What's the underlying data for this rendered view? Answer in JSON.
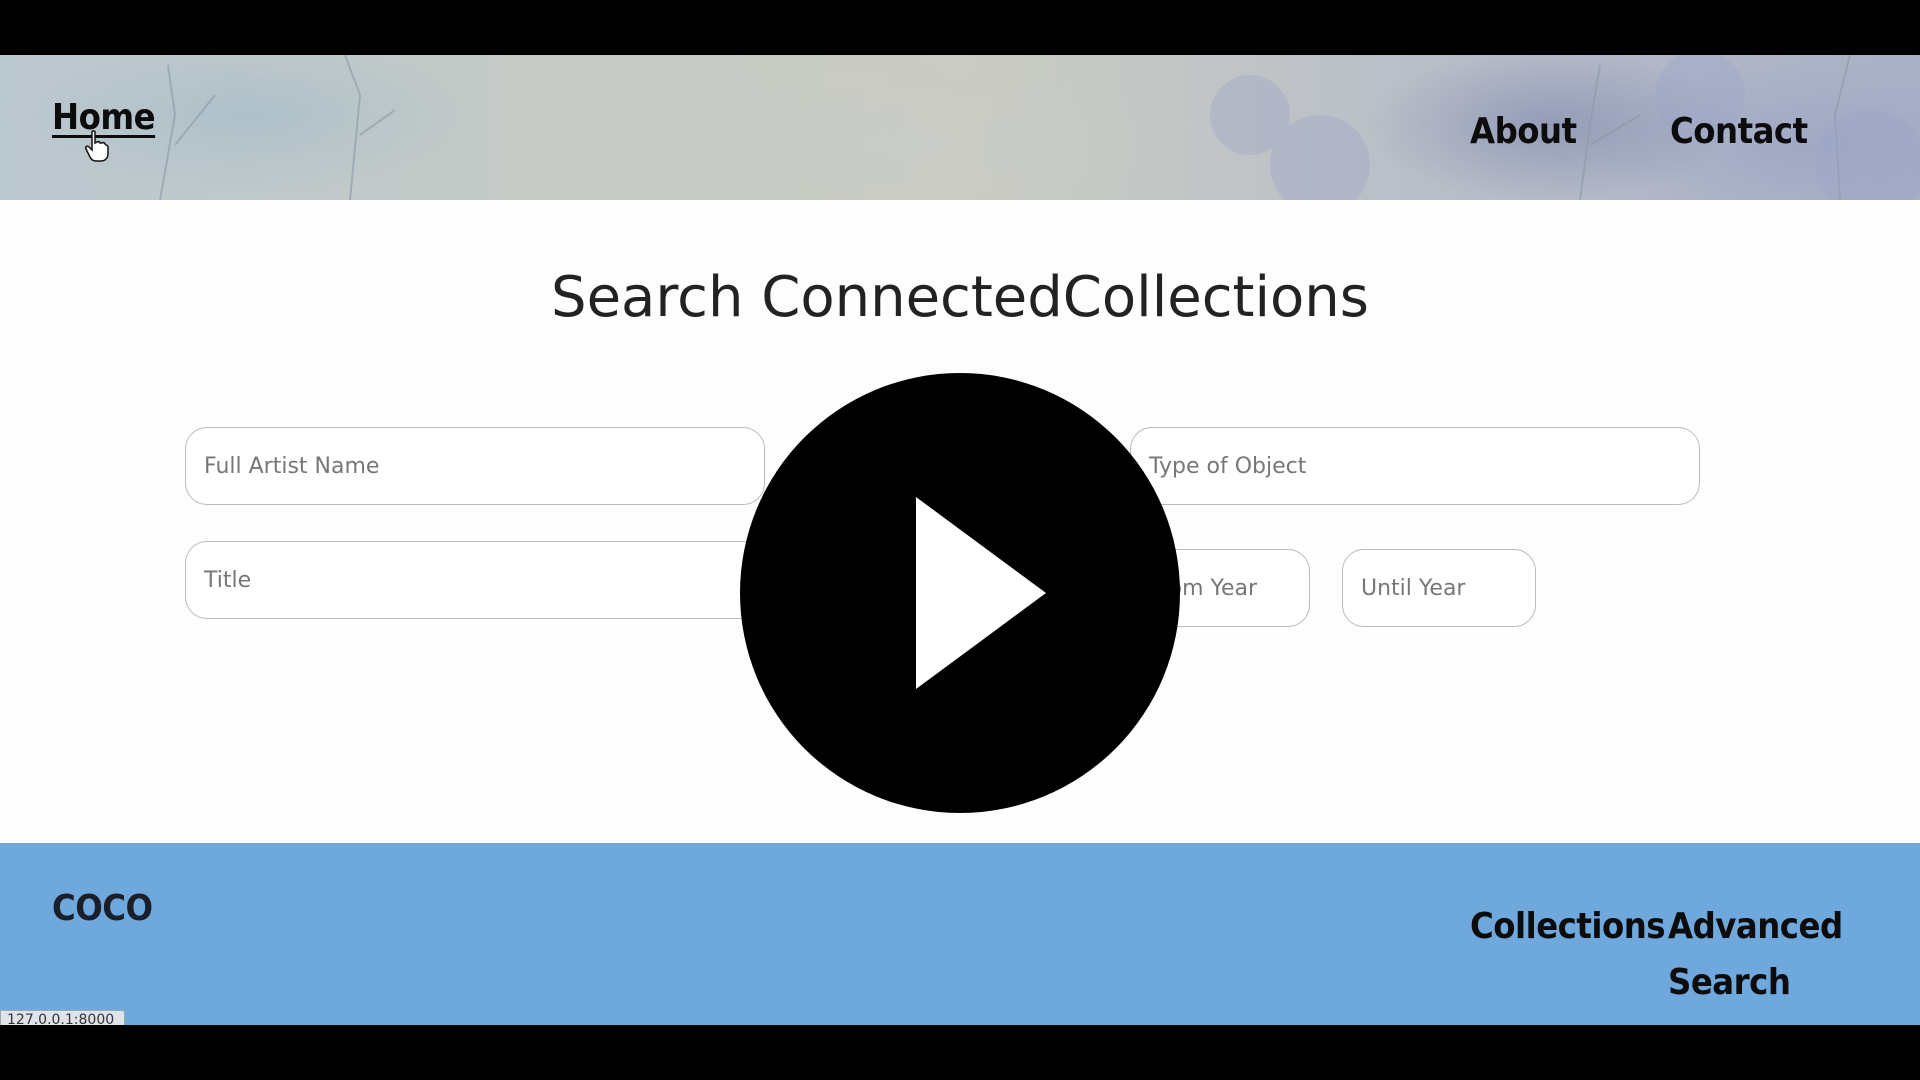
{
  "nav": {
    "home_label": "Home",
    "about_label": "About",
    "contact_label": "Contact"
  },
  "main": {
    "title": "Search ConnectedCollections",
    "inputs": {
      "artist_placeholder": "Full Artist Name",
      "object_placeholder": "Type of Object",
      "title_placeholder": "Title",
      "from_year_placeholder": "From Year",
      "until_year_placeholder": "Until Year"
    }
  },
  "footer": {
    "brand": "COCO",
    "collections_label": "Collections",
    "advanced_search_label": "Advanced Search"
  },
  "status_bar": {
    "url": "127.0.0.1:8000"
  },
  "colors": {
    "footer_bg": "#6fa8dc",
    "page_bg": "#fdfdfd"
  },
  "icons": {
    "cursor": "hand-cursor-icon",
    "play": "play-icon"
  }
}
